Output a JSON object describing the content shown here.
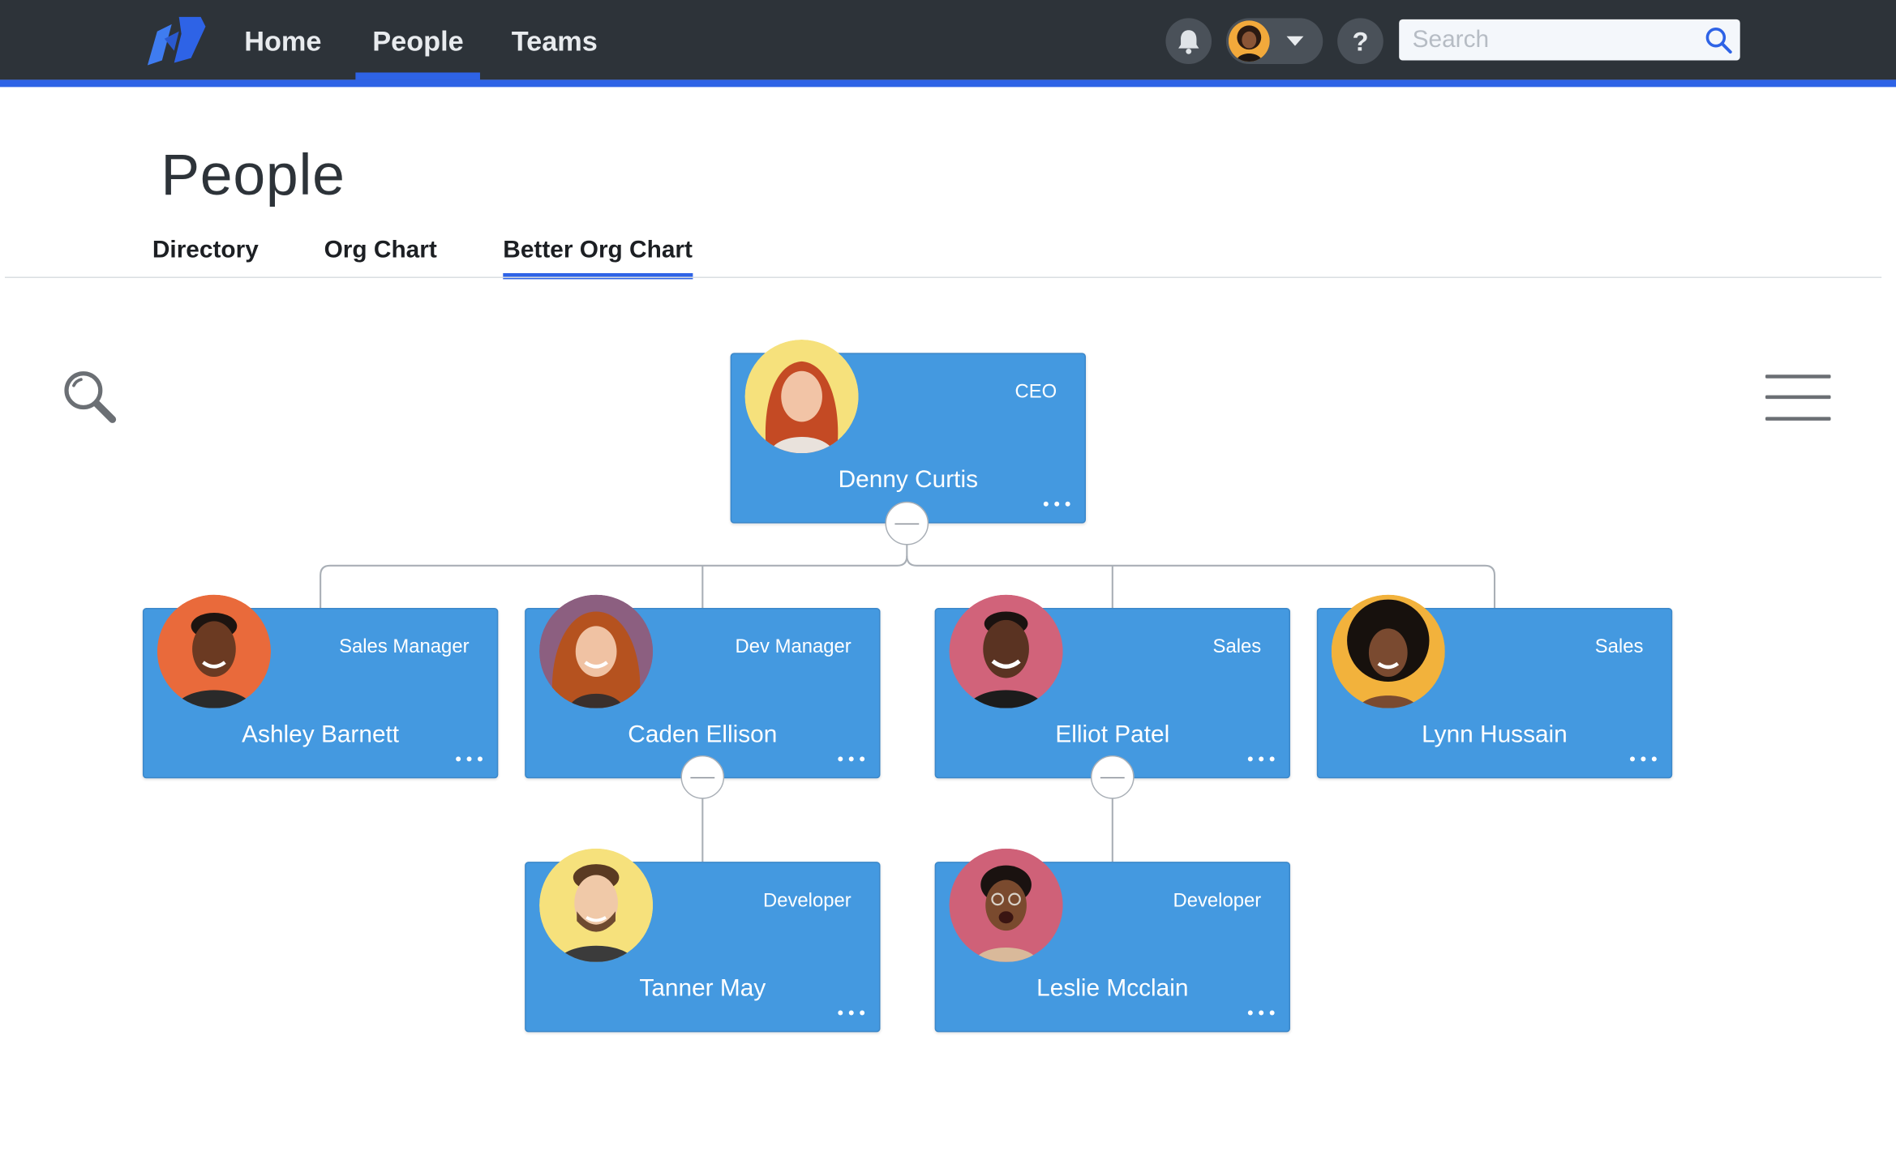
{
  "nav": {
    "logo_icon": "brand-logo-icon",
    "items": [
      {
        "label": "Home",
        "active": false
      },
      {
        "label": "People",
        "active": true
      },
      {
        "label": "Teams",
        "active": false
      }
    ],
    "search_placeholder": "Search",
    "help_label": "?"
  },
  "page": {
    "title": "People",
    "tabs": [
      {
        "label": "Directory",
        "active": false
      },
      {
        "label": "Org Chart",
        "active": false
      },
      {
        "label": "Better Org Chart",
        "active": true
      }
    ]
  },
  "colors": {
    "nav_bg": "#2d3339",
    "accent": "#2e63e6",
    "card_bg": "#4499e0"
  },
  "org": {
    "ceo": {
      "name": "Denny Curtis",
      "role": "CEO",
      "avatar_bg": "#f6e17c",
      "hair": "#c44a24",
      "skin": "#f2c4a6"
    },
    "level1": [
      {
        "name": "Ashley Barnett",
        "role": "Sales Manager",
        "avatar_bg": "#e96a3b",
        "hair": "#1d1410",
        "skin": "#6b3a22"
      },
      {
        "name": "Caden Ellison",
        "role": "Dev Manager",
        "avatar_bg": "#8c5f80",
        "hair": "#b5521f",
        "skin": "#f0c2a3"
      },
      {
        "name": "Elliot Patel",
        "role": "Sales",
        "avatar_bg": "#d1637a",
        "hair": "#1a1210",
        "skin": "#5a3322"
      },
      {
        "name": "Lynn Hussain",
        "role": "Sales",
        "avatar_bg": "#f2b23c",
        "hair": "#17110d",
        "skin": "#7a4a30"
      }
    ],
    "level2": [
      {
        "name": "Tanner May",
        "role": "Developer",
        "avatar_bg": "#f6e17c",
        "hair": "#5a3a22",
        "skin": "#f0c9a8"
      },
      {
        "name": "Leslie Mcclain",
        "role": "Developer",
        "avatar_bg": "#cf6178",
        "hair": "#1a1210",
        "skin": "#7a4a2e"
      }
    ]
  }
}
